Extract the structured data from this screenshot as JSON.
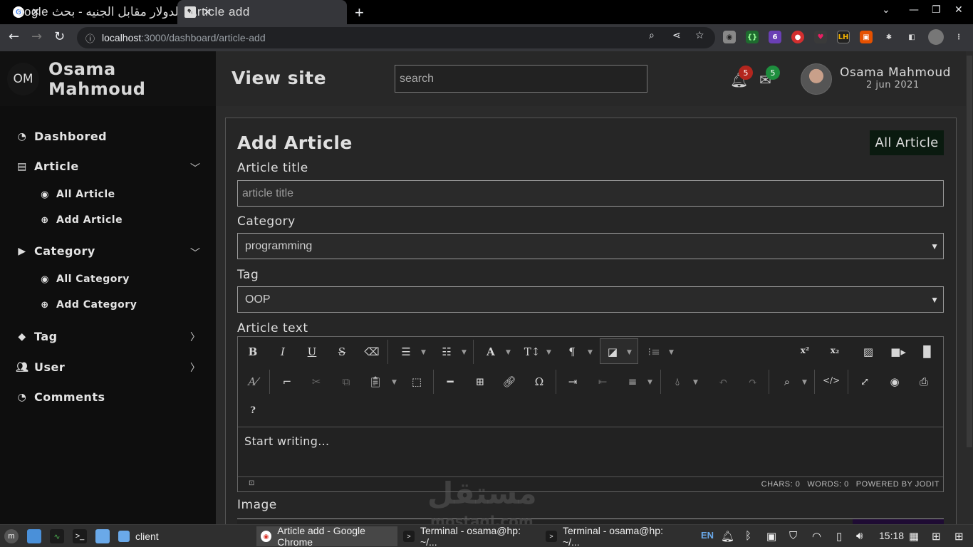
{
  "browser": {
    "tabs": [
      {
        "title": "الدولار مقابل الجنيه - بحث oogle",
        "active": false
      },
      {
        "title": "Article add",
        "active": true
      }
    ],
    "new_tab": "+",
    "url_host": "localhost",
    "url_path": ":3000/dashboard/article-add"
  },
  "header": {
    "initials": "OM",
    "brand_name": "Osama Mahmoud",
    "view_site": "View site",
    "search_placeholder": "search",
    "notifications_count": "5",
    "messages_count": "5",
    "user_name": "Osama Mahmoud",
    "user_date": "2 jun 2021",
    "notification_badge_color": "#b3261e",
    "message_badge_color": "#1e8e3e"
  },
  "sidebar": {
    "dashboard": "Dashbored",
    "article": "Article",
    "all_article": "All Article",
    "add_article": "Add Article",
    "category": "Category",
    "all_category": "All Category",
    "add_category": "Add Category",
    "tag": "Tag",
    "user": "User",
    "comments": "Comments"
  },
  "form": {
    "title": "Add Article",
    "all_article_button": "All Article",
    "article_title_label": "Article title",
    "article_title_placeholder": "article title",
    "category_label": "Category",
    "category_value": "programming",
    "tag_label": "Tag",
    "tag_value": "OOP",
    "article_text_label": "Article text",
    "editor_placeholder": "Start writing...",
    "chars": "CHARS: 0",
    "words": "WORDS: 0",
    "powered_by": "POWERED BY JODIT",
    "image_label": "Image"
  },
  "watermark": {
    "arabic": "مستقل",
    "latin": "mostaql.com"
  },
  "taskbar": {
    "tasks": [
      {
        "label": "client"
      },
      {
        "label": "Article add - Google Chrome"
      },
      {
        "label": "Terminal - osama@hp: ~/..."
      },
      {
        "label": "Terminal - osama@hp: ~/..."
      }
    ],
    "language": "EN",
    "time": "15:18"
  }
}
